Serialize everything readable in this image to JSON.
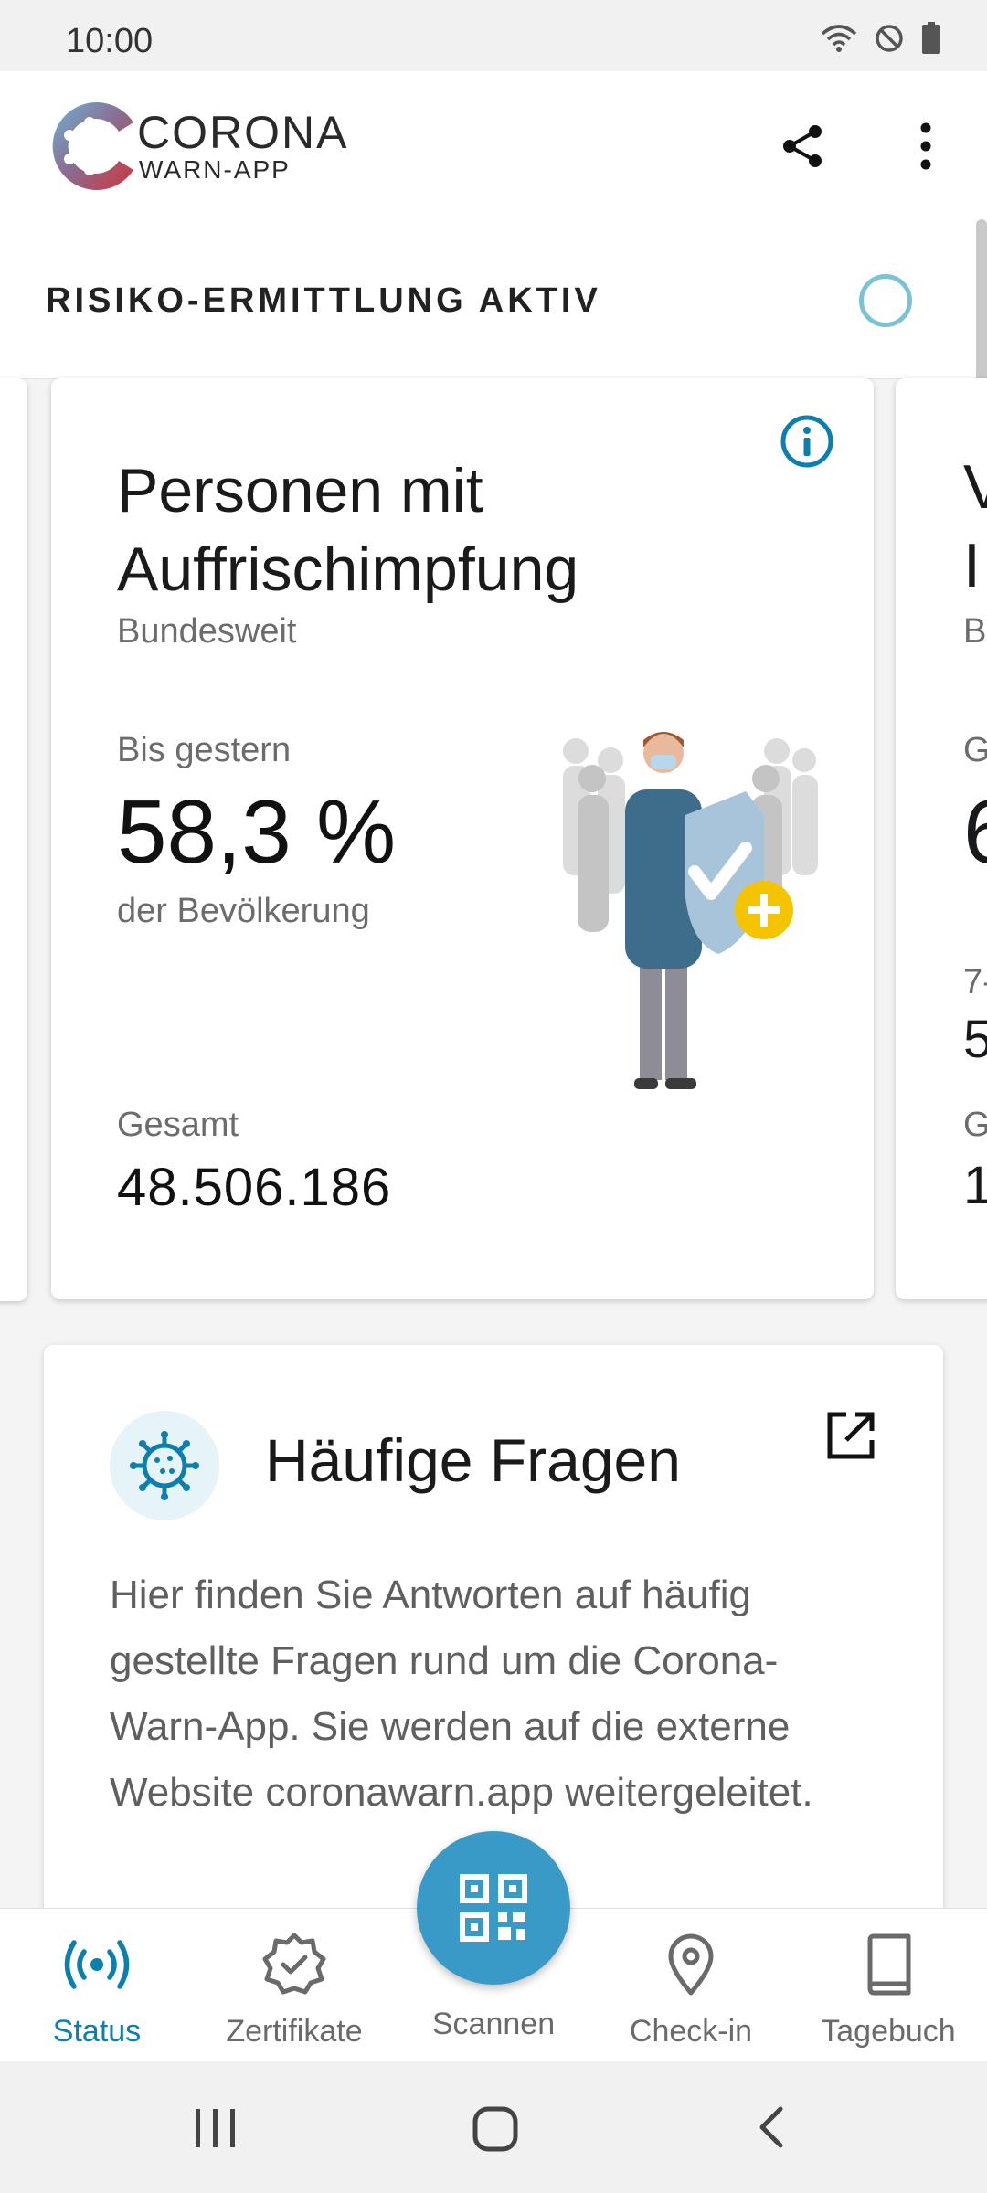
{
  "status_bar": {
    "time": "10:00"
  },
  "header": {
    "brand_line1": "CORONA",
    "brand_line2": "WARN-APP"
  },
  "risk": {
    "title": "RISIKO-ERMITTLUNG AKTIV"
  },
  "stats_card": {
    "title": "Personen mit Auffrischimpfung",
    "subtitle": "Bundesweit",
    "label_until": "Bis gestern",
    "primary_value": "58,3 %",
    "primary_unit": "der Bevölkerung",
    "label_total": "Gesamt",
    "total_value": "48.506.186"
  },
  "next_card_peek": {
    "title_l1": "V",
    "title_l2": "I",
    "sub": "B",
    "label": "G",
    "value": "6",
    "row1_label": "7-",
    "row1_value": "5",
    "row2_label": "G",
    "row2_value": "1"
  },
  "faq": {
    "title": "Häufige Fragen",
    "text": "Hier finden Sie Antworten auf häufig gestellte Fragen rund um die Corona-Warn-App. Sie werden auf die externe Website coronawarn.app weitergeleitet."
  },
  "bottom_nav": {
    "status": "Status",
    "zertifikate": "Zertifikate",
    "scannen": "Scannen",
    "checkin": "Check-in",
    "tagebuch": "Tagebuch"
  },
  "colors": {
    "accent": "#0b7fae",
    "fab": "#3a9ac7",
    "plus_badge": "#f5c400"
  }
}
